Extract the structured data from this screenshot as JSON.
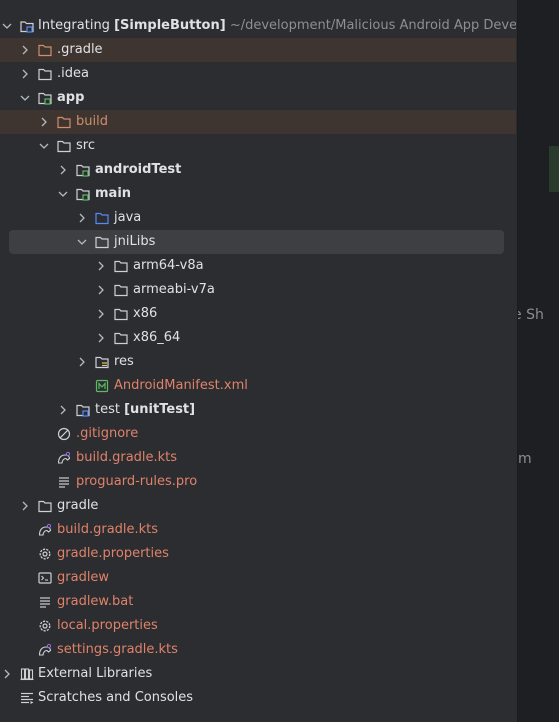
{
  "project_tree": {
    "root": {
      "name": "Integrating",
      "module_tag": "[SimpleButton]",
      "path": "~/development/Malicious Android App Developm"
    },
    "items": [
      {
        "label": "Integrating",
        "icon": "project-module-icon"
      },
      {
        "label": ".gradle",
        "icon": "folder-icon"
      },
      {
        "label": ".idea",
        "icon": "folder-icon"
      },
      {
        "label": "app",
        "icon": "module-folder-icon"
      },
      {
        "label": "build",
        "icon": "folder-icon"
      },
      {
        "label": "src",
        "icon": "folder-icon"
      },
      {
        "label": "androidTest",
        "icon": "test-folder-icon"
      },
      {
        "label": "main",
        "icon": "source-folder-icon"
      },
      {
        "label": "java",
        "icon": "source-folder-icon"
      },
      {
        "label": "jniLibs",
        "icon": "folder-icon"
      },
      {
        "label": "arm64-v8a",
        "icon": "folder-icon"
      },
      {
        "label": "armeabi-v7a",
        "icon": "folder-icon"
      },
      {
        "label": "x86",
        "icon": "folder-icon"
      },
      {
        "label": "x86_64",
        "icon": "folder-icon"
      },
      {
        "label": "res",
        "icon": "resources-folder-icon"
      },
      {
        "label": "AndroidManifest.xml",
        "icon": "manifest-file-icon"
      },
      {
        "label": "test",
        "tag": "[unitTest]",
        "icon": "test-folder-icon"
      },
      {
        "label": ".gitignore",
        "icon": "gitignore-file-icon"
      },
      {
        "label": "build.gradle.kts",
        "icon": "gradle-file-icon"
      },
      {
        "label": "proguard-rules.pro",
        "icon": "text-file-icon"
      },
      {
        "label": "gradle",
        "icon": "folder-icon"
      },
      {
        "label": "build.gradle.kts",
        "icon": "gradle-file-icon"
      },
      {
        "label": "gradle.properties",
        "icon": "settings-file-icon"
      },
      {
        "label": "gradlew",
        "icon": "shell-script-icon"
      },
      {
        "label": "gradlew.bat",
        "icon": "text-file-icon"
      },
      {
        "label": "local.properties",
        "icon": "settings-file-icon"
      },
      {
        "label": "settings.gradle.kts",
        "icon": "gradle-file-icon"
      },
      {
        "label": "External Libraries",
        "icon": "libraries-icon"
      },
      {
        "label": "Scratches and Consoles",
        "icon": "scratches-icon"
      }
    ]
  },
  "editor_fragments": {
    "frag1": "e Sh",
    "frag2": "m"
  },
  "colors": {
    "background": "#2b2d30",
    "editor_background": "#1e1f22",
    "selection": "#3d3f43",
    "excluded_highlight": "#3e3530",
    "text": "#dfe1e5",
    "excluded_text": "#cf8e6d",
    "untracked_text": "#e0826a",
    "source_folder_blue": "#548af7",
    "module_green": "#5fb865"
  }
}
